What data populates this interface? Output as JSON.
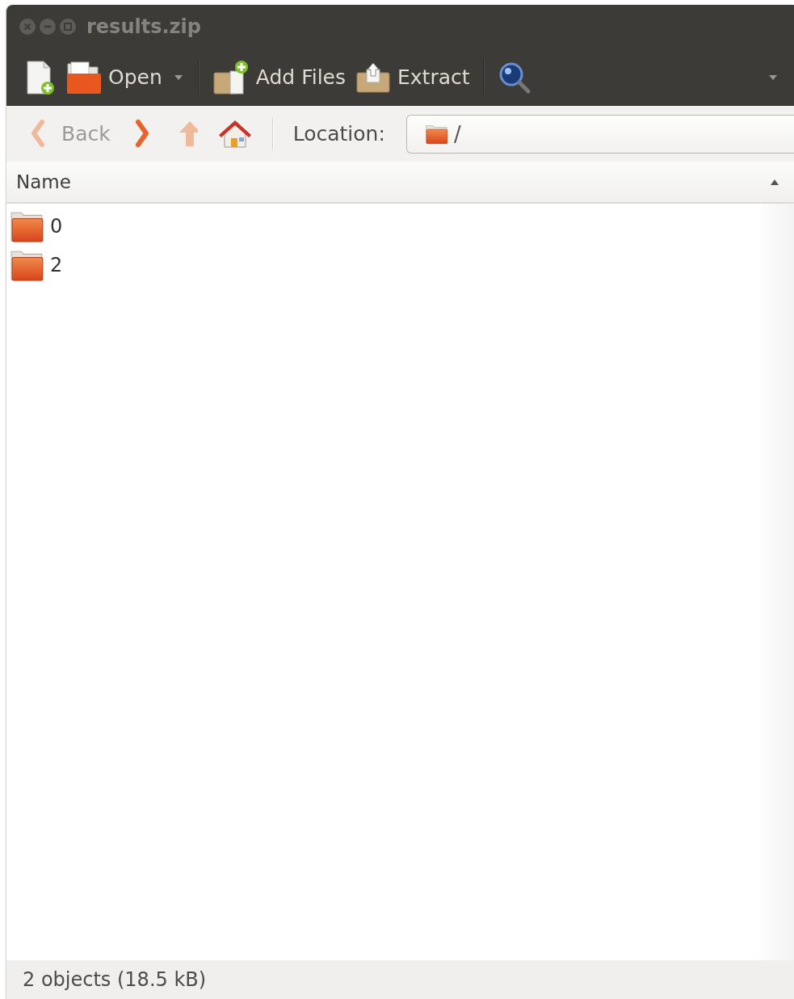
{
  "window": {
    "title": "results.zip"
  },
  "toolbar": {
    "items": [
      {
        "kind": "new"
      },
      {
        "kind": "open",
        "label": "Open",
        "dropdown": true
      },
      {
        "kind": "add",
        "label": "Add Files"
      },
      {
        "kind": "extract",
        "label": "Extract"
      },
      {
        "kind": "search"
      }
    ]
  },
  "navigation": {
    "buttons": [
      {
        "kind": "back",
        "label": "Back",
        "disabled": true
      },
      {
        "kind": "forward",
        "disabled": false
      },
      {
        "kind": "up",
        "disabled": true
      },
      {
        "kind": "home",
        "disabled": false
      }
    ],
    "location_label": "Location:",
    "location": "/"
  },
  "table": {
    "columns": [
      {
        "label": "Name",
        "sorted_ascending": true
      }
    ],
    "rows": [
      {
        "name": "0",
        "selected": false
      },
      {
        "name": "2",
        "selected": false
      }
    ]
  },
  "status_bar": "2 objects (18.5 kB)"
}
